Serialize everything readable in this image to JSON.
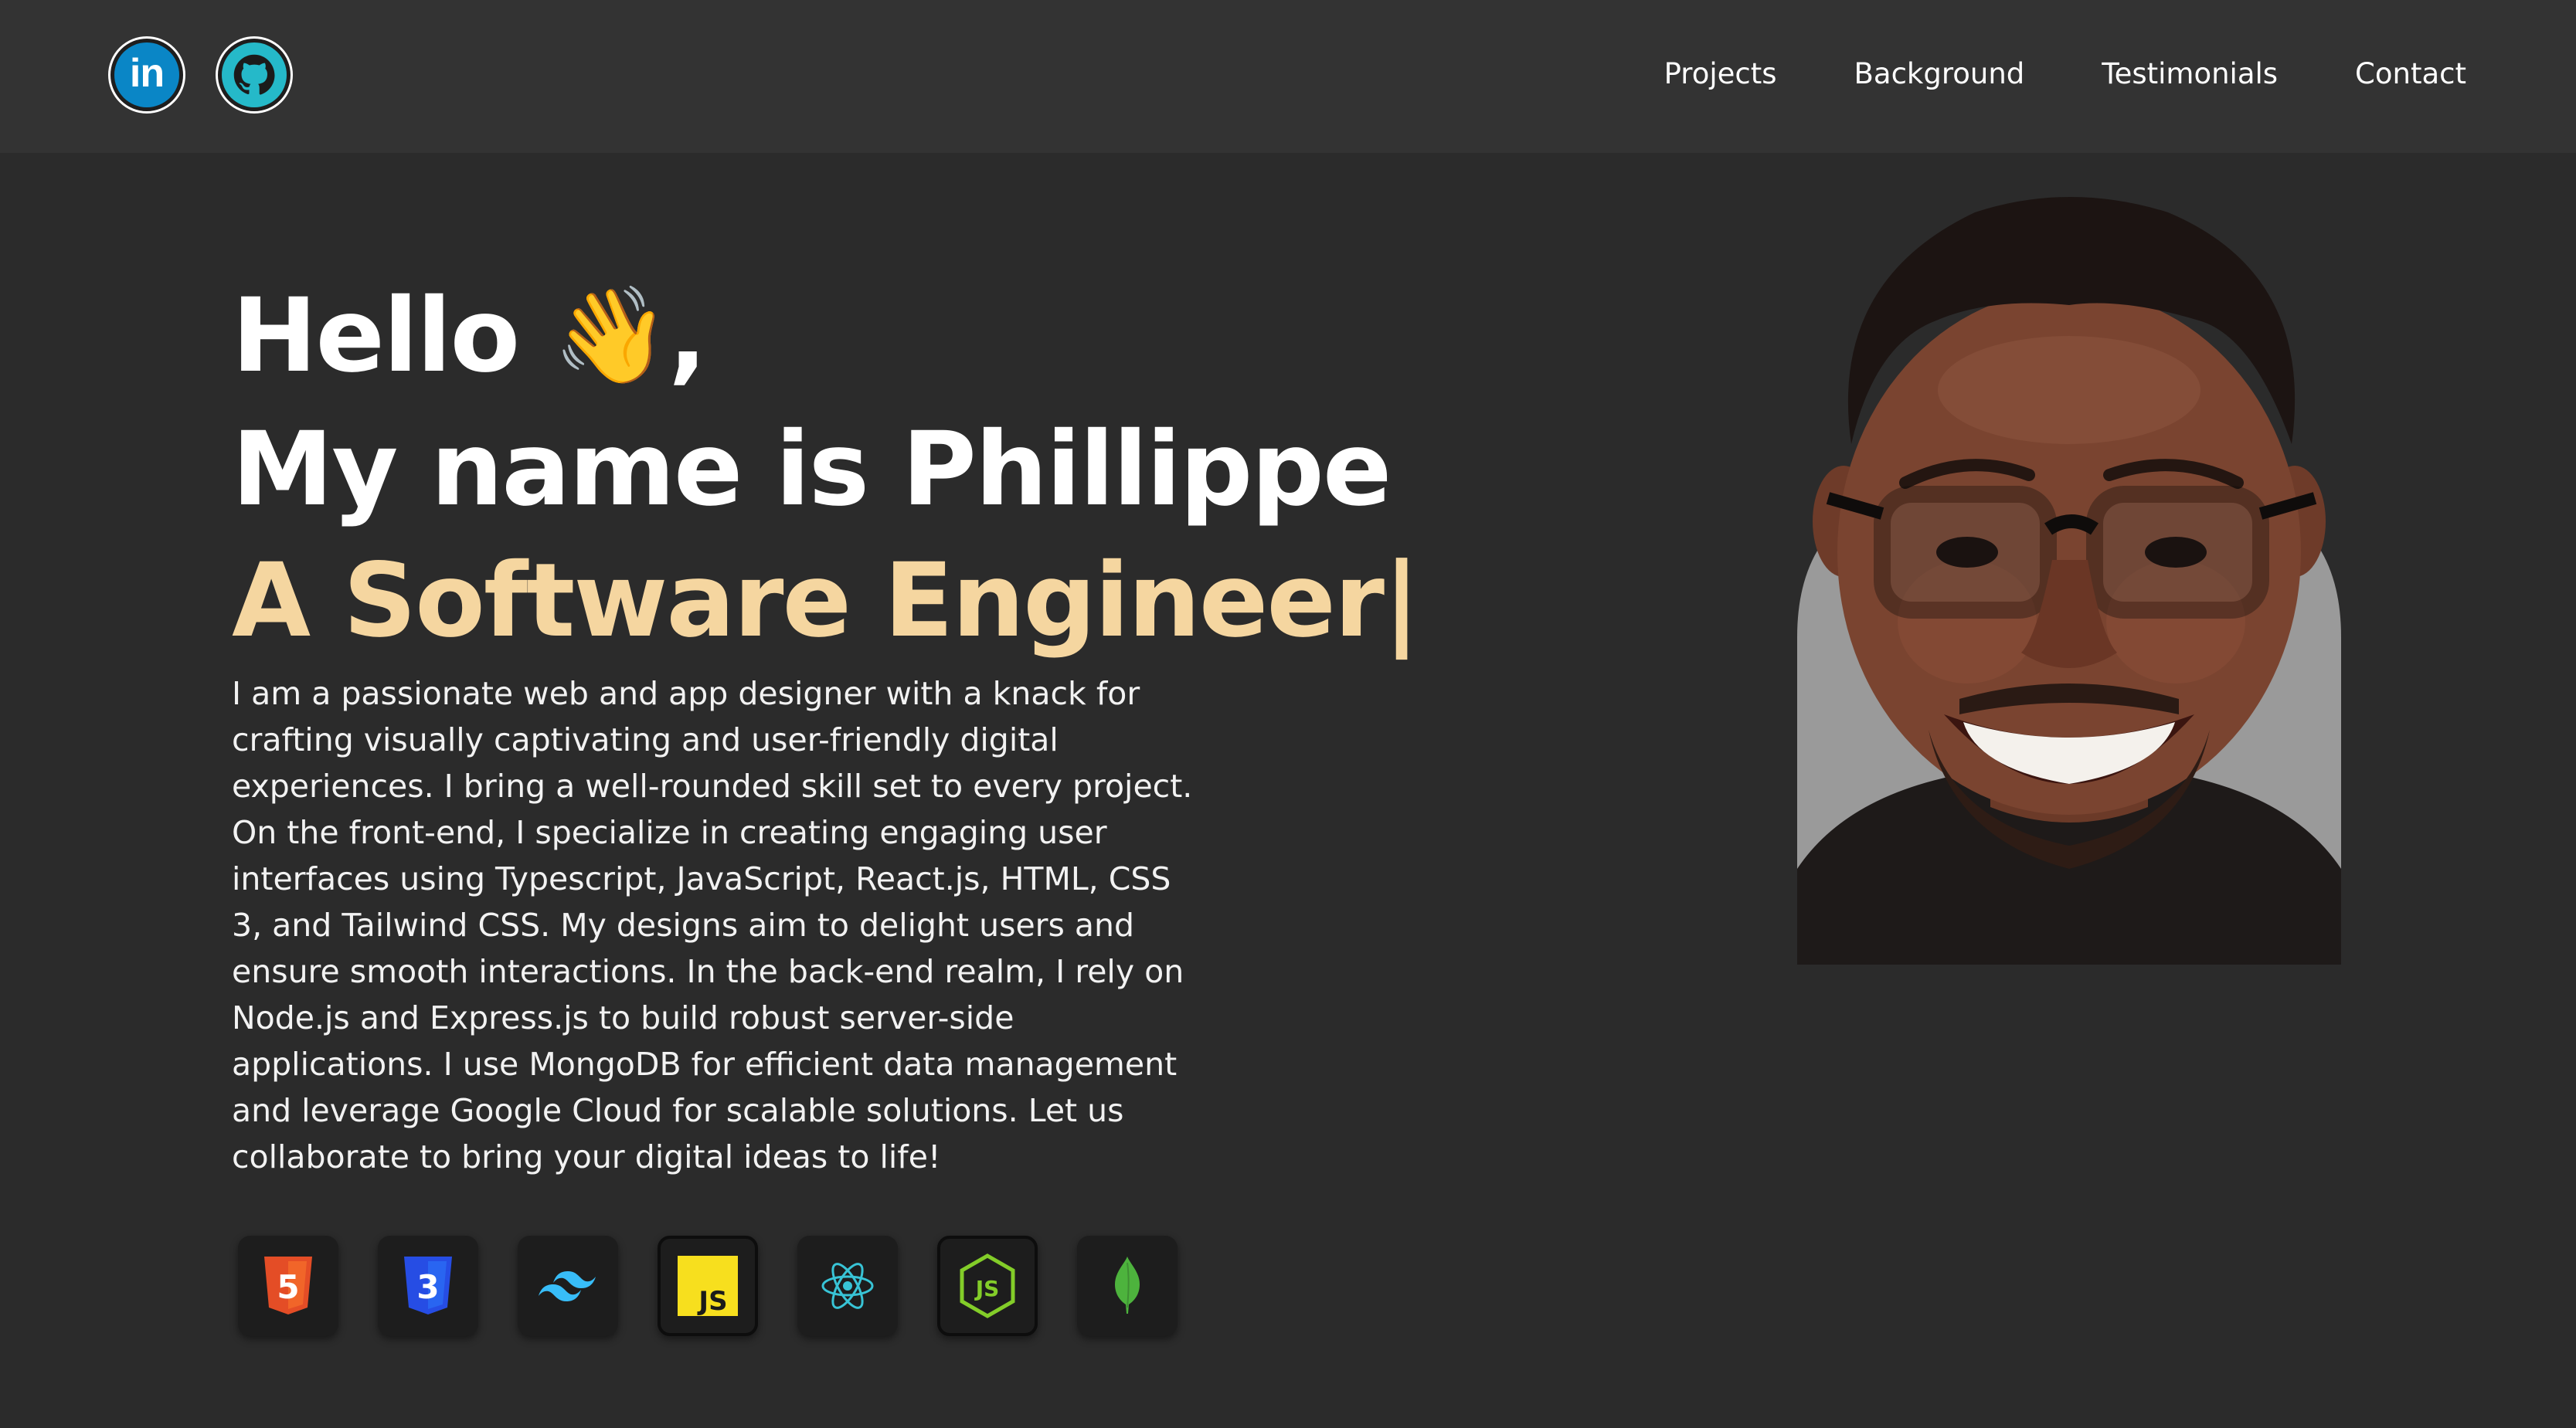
{
  "header": {
    "social_links": [
      {
        "name": "linkedin",
        "icon": "linkedin-icon",
        "text": "in",
        "color": "#0a86c6"
      },
      {
        "name": "github",
        "icon": "github-icon",
        "color": "#25b9c9"
      }
    ],
    "nav": [
      {
        "label": "Projects"
      },
      {
        "label": "Background"
      },
      {
        "label": "Testimonials"
      },
      {
        "label": "Contact"
      }
    ]
  },
  "hero": {
    "greeting": "Hello",
    "wave_emoji": "👋",
    "greeting_suffix": ",",
    "name_line": "My name is Phillippe",
    "role_line": "A Software Engineer|",
    "role_color": "#f5d6a0",
    "bio": "I am a passionate web and app designer with a knack for crafting visually captivating and user-friendly digital experiences. I bring a well-rounded skill set to every project. On the front-end, I specialize in creating engaging user interfaces using Typescript, JavaScript, React.js, HTML, CSS 3, and Tailwind CSS. My designs aim to delight users and ensure smooth interactions. In the back-end realm, I rely on Node.js and Express.js to build robust server-side applications. I use MongoDB for efficient data management and leverage Google Cloud for scalable solutions. Let us collaborate to bring your digital ideas to life!"
  },
  "skills": [
    {
      "icon": "html5-icon",
      "text": "5",
      "color": "#e44d26"
    },
    {
      "icon": "css3-icon",
      "text": "3",
      "color": "#264de4"
    },
    {
      "icon": "tailwind-icon",
      "color": "#38bdf8"
    },
    {
      "icon": "javascript-icon",
      "text": "JS",
      "color": "#f7df1e"
    },
    {
      "icon": "react-icon",
      "color": "#61dafb"
    },
    {
      "icon": "nodejs-icon",
      "text": "JS",
      "color": "#83cd29"
    },
    {
      "icon": "mongodb-icon",
      "color": "#4db33d"
    }
  ],
  "portrait": {
    "icon": "profile-photo"
  },
  "colors": {
    "page_background": "#2b2b2b",
    "header_background": "#333333"
  }
}
